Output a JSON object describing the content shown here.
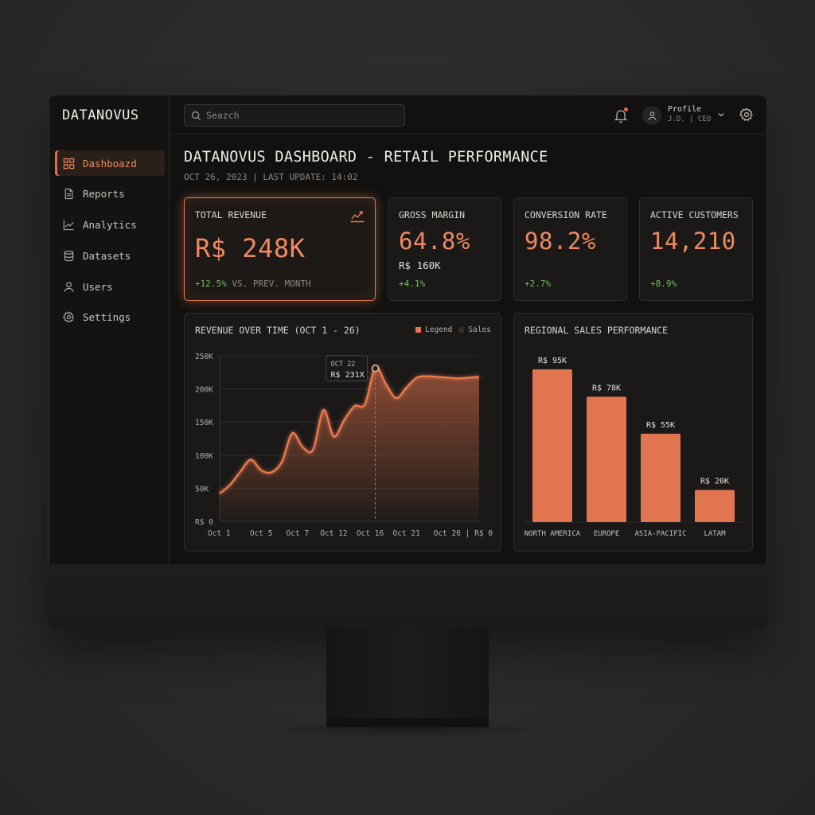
{
  "brand": "DATANOVUS",
  "colors": {
    "accent": "#e8754d",
    "positive": "#6dc25b",
    "bg": "#121110",
    "panel": "#1a1918"
  },
  "sidebar": {
    "items": [
      {
        "label": "Dashboazd",
        "icon": "grid-icon",
        "active": true
      },
      {
        "label": "Reports",
        "icon": "document-icon",
        "active": false
      },
      {
        "label": "Analytics",
        "icon": "chart-line-icon",
        "active": false
      },
      {
        "label": "Datasets",
        "icon": "database-icon",
        "active": false
      },
      {
        "label": "Users",
        "icon": "user-icon",
        "active": false
      },
      {
        "label": "Settings",
        "icon": "gear-icon",
        "active": false
      }
    ]
  },
  "topbar": {
    "search_placeholder": "Seazch",
    "profile_name": "Profile",
    "profile_role": "J.D. | CEO"
  },
  "page": {
    "title": "DATANOVUS DASHBOARD - RETAIL PERFORMANCE",
    "subtitle": "OCT 26, 2023 | LAST UPDATE: 14:02"
  },
  "kpis": {
    "revenue": {
      "label": "TOTAL REVENUE",
      "value": "R$ 248K",
      "delta": "+12.5%",
      "delta_note": "VS. PREV. MONTH"
    },
    "margin": {
      "label": "GROSS MARGIN",
      "value": "64.8%",
      "sub": "R$ 160K",
      "delta": "+4.1%"
    },
    "conversion": {
      "label": "CONVERSION RATE",
      "value": "98.2%",
      "delta": "+2.7%"
    },
    "customers": {
      "label": "ACTIVE CUSTOMERS",
      "value": "14,210",
      "delta": "+8.9%"
    }
  },
  "chart_data": [
    {
      "type": "area",
      "title": "REVENUE OVER TIME (OCT 1 - 26)",
      "legend": [
        "Legend",
        "Sales"
      ],
      "ytick_labels": [
        "R$ 0",
        "50K",
        "100K",
        "150K",
        "200K",
        "250K"
      ],
      "ylim": [
        0,
        250000
      ],
      "xlim": [
        1,
        26
      ],
      "xtick_labels": [
        "Oct 1",
        "Oct 5",
        "Oct 7",
        "Oct 12",
        "Oct 16",
        "Oct 21",
        "Oct 26 | R$ 0"
      ],
      "xtick_values": [
        1,
        5,
        8.5,
        12,
        15.5,
        19,
        23.5
      ],
      "x": [
        1,
        2,
        3,
        4,
        5,
        6,
        7,
        8,
        9,
        10,
        11,
        12,
        13,
        14,
        15,
        16,
        17,
        18,
        19,
        20,
        21,
        22,
        23,
        24,
        25,
        26
      ],
      "values": [
        42000,
        55000,
        75000,
        93000,
        77000,
        74000,
        90000,
        133000,
        112000,
        108000,
        168000,
        128000,
        153000,
        174000,
        177000,
        232000,
        208000,
        186000,
        202000,
        217000,
        219000,
        218000,
        217000,
        216000,
        217000,
        218000
      ],
      "grid": true,
      "annotation": {
        "label": "OCT 22",
        "value": "R$ 231X",
        "x": 16,
        "y": 231000
      }
    },
    {
      "type": "bar",
      "title": "REGIONAL SALES PERFORMANCE",
      "categories": [
        "NORTH AMERICA",
        "EUROPE",
        "ASIA-PACIFIC",
        "LATAM"
      ],
      "values": [
        95000,
        78000,
        55000,
        20000
      ],
      "data_labels": [
        "R$ 95K",
        "R$ 78K",
        "R$ 55K",
        "R$ 20K"
      ],
      "ylim": [
        0,
        100000
      ]
    }
  ]
}
